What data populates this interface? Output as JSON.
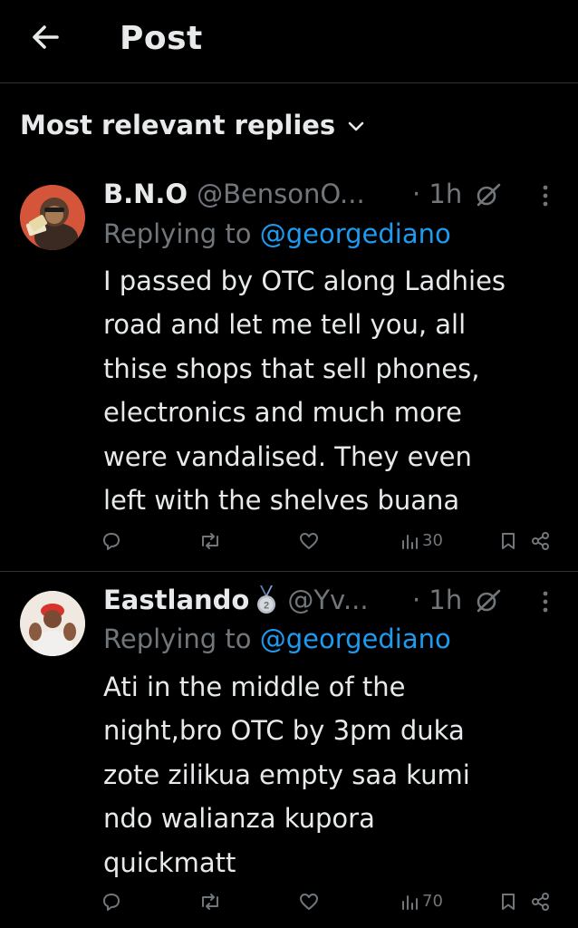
{
  "header": {
    "back_icon": "arrow-left-icon",
    "title": "Post"
  },
  "sort": {
    "label": "Most relevant replies",
    "icon": "chevron-down-icon"
  },
  "replies": [
    {
      "display_name": "B.N.O",
      "handle": "@BensonO...",
      "time": "· 1h",
      "badge": "",
      "replying_prefix": "Replying to",
      "replying_to": "@georgediano",
      "text": "I passed by OTC along Ladhies\nroad and let me tell you, all\nthise shops that sell phones,\nelectronics and much more\nwere vandalised.  They even\nleft with the shelves buana",
      "views": "30"
    },
    {
      "display_name": "Eastlando",
      "handle": "@Yv...",
      "time": "· 1h",
      "badge": "second-place-medal-icon",
      "replying_prefix": "Replying to",
      "replying_to": "@georgediano",
      "text": "Ati in the middle of the\nnight,bro OTC by 3pm duka\nzote zilikua empty saa kumi\nndo walianza kupora\nquickmatt",
      "views": "70"
    }
  ],
  "colors": {
    "background": "#000000",
    "text": "#e7e9ea",
    "muted": "#71767b",
    "accent": "#1d9bf0",
    "divider": "#2f3336"
  }
}
